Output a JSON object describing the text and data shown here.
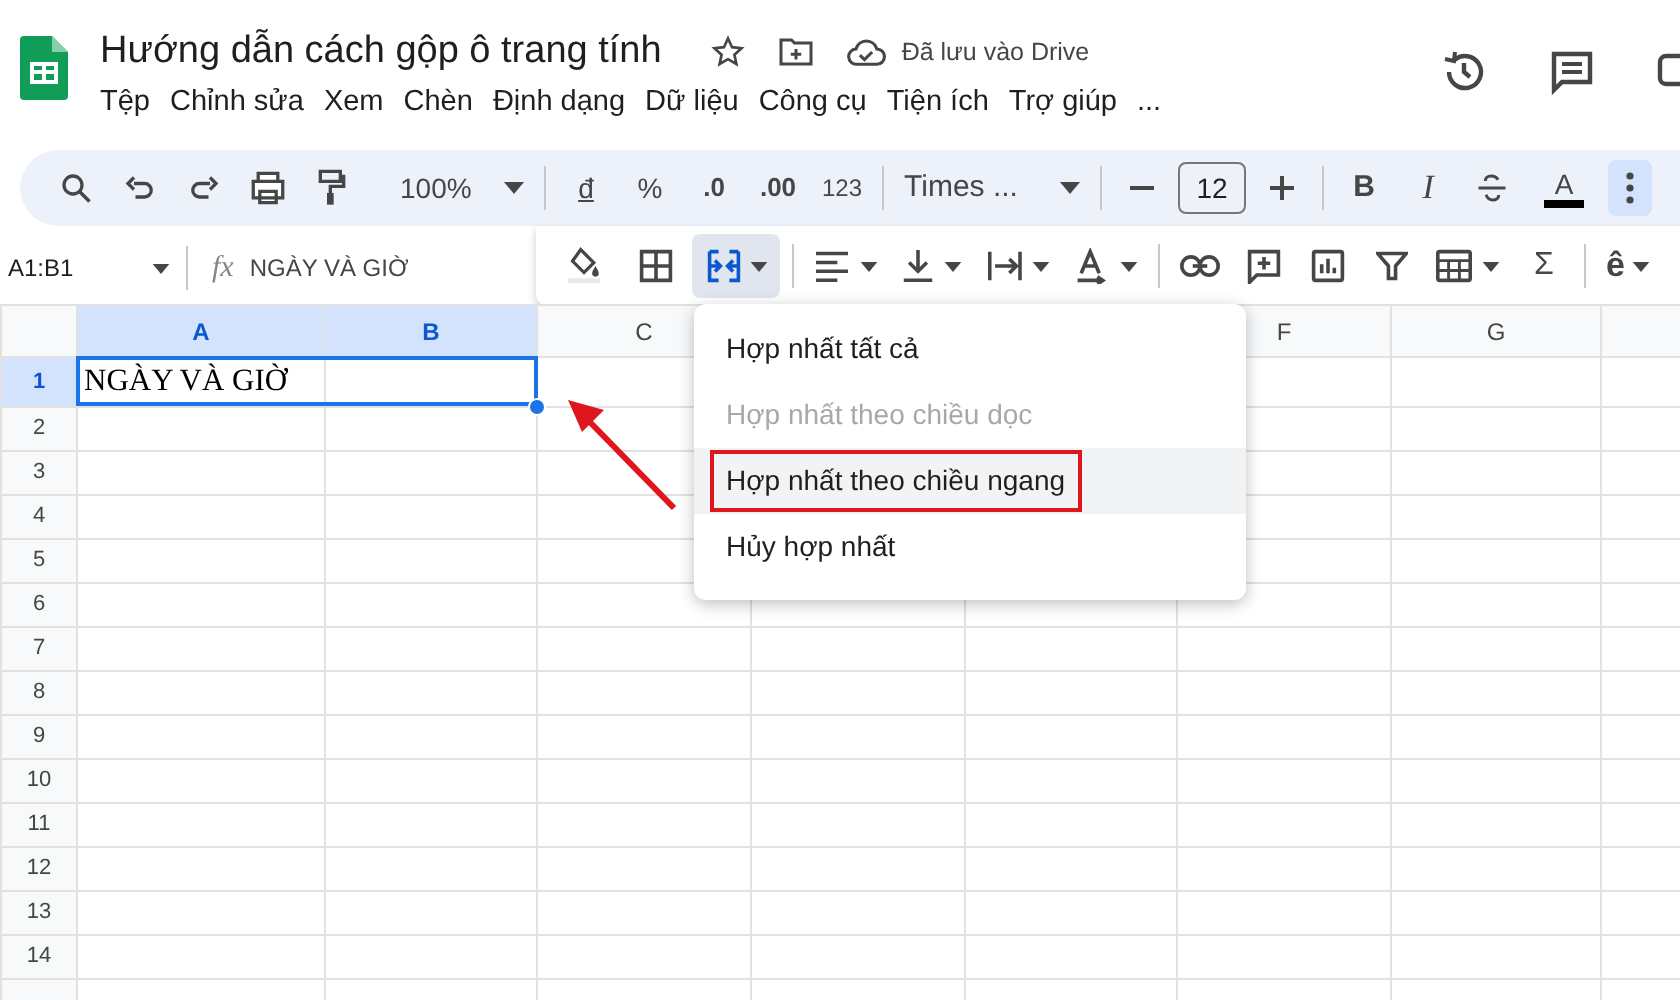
{
  "document": {
    "title": "Hướng dẫn cách gộp ô trang tính",
    "save_status": "Đã lưu vào Drive"
  },
  "menu": [
    "Tệp",
    "Chỉnh sửa",
    "Xem",
    "Chèn",
    "Định dạng",
    "Dữ liệu",
    "Công cụ",
    "Tiện ích",
    "Trợ giúp",
    "..."
  ],
  "toolbar": {
    "zoom": "100%",
    "currency": "đ",
    "percent": "%",
    "decrease_decimals": ".0",
    "increase_decimals": ".00",
    "number_format": "123",
    "font": "Times ...",
    "font_size": "12",
    "bold": "B",
    "italic": "I",
    "text_color": "A"
  },
  "format_toolbar": {
    "merge_expanded": true,
    "sum": "Σ",
    "input_tools": "ê"
  },
  "formula_bar": {
    "name_box": "A1:B1",
    "fx": "fx",
    "formula": "NGÀY VÀ GIỜ"
  },
  "sheet": {
    "columns": [
      {
        "label": "A",
        "selected": true
      },
      {
        "label": "B",
        "selected": true
      },
      {
        "label": "C",
        "selected": false
      },
      {},
      {},
      {
        "label": "F",
        "selected": false
      },
      {
        "label": "G",
        "selected": false
      },
      {
        "selected": false
      }
    ],
    "rows": [
      {
        "label": "1",
        "selected": true
      },
      {
        "label": "2",
        "selected": false
      },
      {
        "label": "3",
        "selected": false
      },
      {
        "label": "4",
        "selected": false
      },
      {
        "label": "5",
        "selected": false
      },
      {
        "label": "6",
        "selected": false
      },
      {
        "label": "7",
        "selected": false
      },
      {
        "label": "8",
        "selected": false
      },
      {
        "label": "9",
        "selected": false
      },
      {
        "label": "10",
        "selected": false
      },
      {
        "label": "11",
        "selected": false
      },
      {
        "label": "12",
        "selected": false
      },
      {
        "label": "13",
        "selected": false
      },
      {
        "label": "14",
        "selected": false
      }
    ],
    "cell_a1": "NGÀY VÀ GIỜ"
  },
  "merge_menu": [
    {
      "label": "Hợp nhất tất cả",
      "disabled": false,
      "highlighted": false
    },
    {
      "label": "Hợp nhất theo chiều dọc",
      "disabled": true,
      "highlighted": false
    },
    {
      "label": "Hợp nhất theo chiều ngang",
      "disabled": false,
      "highlighted": true
    },
    {
      "label": "Hủy hợp nhất",
      "disabled": false,
      "highlighted": false
    }
  ]
}
